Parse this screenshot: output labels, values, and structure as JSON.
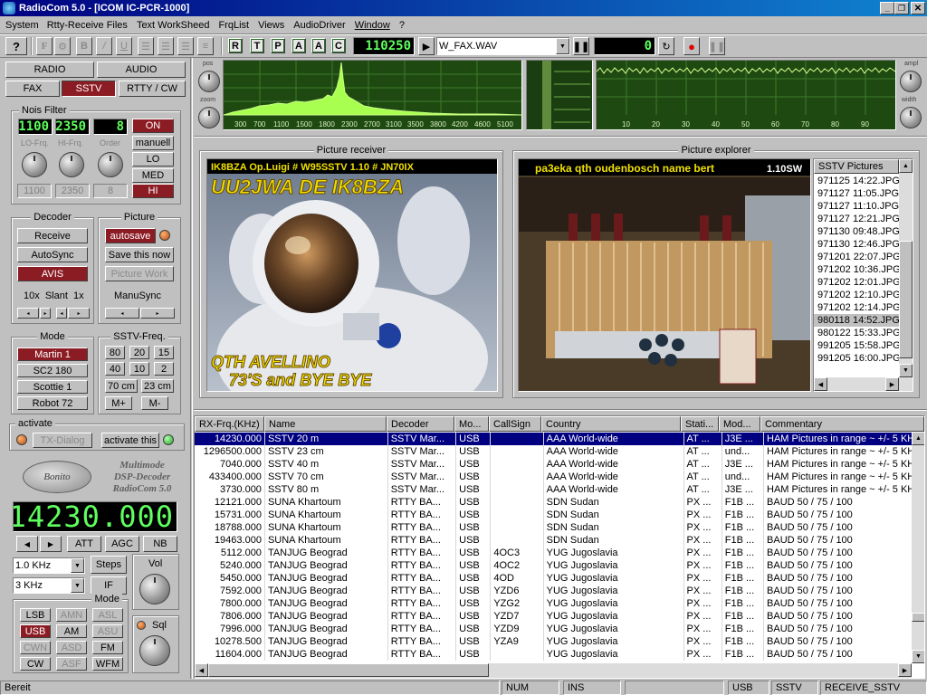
{
  "window": {
    "title": "RadioCom 5.0 - [ICOM IC-PCR-1000]",
    "min_icon": "minimize-icon",
    "max_icon": "restore-icon",
    "close_icon": "close-icon"
  },
  "menu": [
    "System",
    "Rtty-Receive Files",
    "Text WorkSheed",
    "FrqList",
    "Views",
    "AudioDriver",
    "Window",
    "?"
  ],
  "toolbar": {
    "help_icon": "help-icon",
    "format_buttons": [
      "F",
      "",
      "B",
      "/",
      "U",
      "",
      "",
      ""
    ],
    "tool_buttons": [
      "R",
      "T",
      "P",
      "A",
      "A",
      "C"
    ],
    "counter": "110250",
    "file": "W_FAX.WAV",
    "position": "0"
  },
  "mode_tabs": {
    "radio": "RADIO",
    "audio": "AUDIO",
    "fax": "FAX",
    "sstv": "SSTV",
    "rtty": "RTTY / CW"
  },
  "noise_filter": {
    "title": "Nois Filter",
    "lcd": [
      "1100",
      "2350",
      "8"
    ],
    "labels": [
      "LO-Frq.",
      "HI-Frq.",
      "Order"
    ],
    "values": [
      "1100",
      "2350",
      "8"
    ],
    "buttons": [
      "ON",
      "manuell",
      "LO",
      "MED",
      "HI"
    ]
  },
  "decoder": {
    "title": "Decoder",
    "buttons": [
      "Receive",
      "AutoSync",
      "AVIS"
    ],
    "slant": "10x  Slant  1x"
  },
  "picture": {
    "title": "Picture",
    "buttons": [
      "autosave",
      "Save this now",
      "Picture Work"
    ],
    "manusync": "ManuSync"
  },
  "mode": {
    "title": "Mode",
    "items": [
      "Martin 1",
      "SC2 180",
      "Scottie 1",
      "Robot 72"
    ]
  },
  "sstv_freq": {
    "title": "SSTV-Freq.",
    "buttons": [
      "80",
      "20",
      "15",
      "40",
      "10",
      "2",
      "70 cm",
      "23 cm",
      "M+",
      "M-"
    ]
  },
  "activate": {
    "title": "activate",
    "tx_dialog": "TX-Dialog",
    "activate_this": "activate this"
  },
  "brand": {
    "logo": "Bonito",
    "line1": "Multimode",
    "line2": "DSP-Decoder",
    "line3": "RadioCom 5.0"
  },
  "frequency": "14230.000",
  "tuning": {
    "att": "ATT",
    "agc": "AGC",
    "nb": "NB",
    "step_value": "1.0 KHz",
    "steps": "Steps",
    "bw_value": "3 KHz",
    "if": "IF",
    "vol": "Vol",
    "sql": "Sql",
    "mode_title": "Mode",
    "modes": [
      "LSB",
      "AMN",
      "ASL",
      "USB",
      "AM",
      "ASU",
      "CWN",
      "ASD",
      "FM",
      "CW",
      "ASF",
      "WFM"
    ]
  },
  "spectrum": {
    "pos": "pos",
    "zoom": "zoom",
    "ampl": "ampl",
    "width": "width",
    "freq_ticks": [
      "300",
      "700",
      "1100",
      "1500",
      "1800",
      "2300",
      "2700",
      "3100",
      "3500",
      "3800",
      "4200",
      "4600",
      "5100"
    ],
    "time_ticks": [
      "10",
      "20",
      "30",
      "40",
      "50",
      "60",
      "70",
      "80",
      "90"
    ]
  },
  "picture_receiver": {
    "title": "Picture receiver",
    "overlay_top": "IK8BZA  Op.Luigi # W95SSTV  1.10 # JN70IX",
    "overlay_callsign": "UU2JWA DE IK8BZA",
    "overlay_bottom1": "QTH AVELLINO",
    "overlay_bottom2": "73'S and BYE BYE"
  },
  "picture_explorer": {
    "title": "Picture explorer",
    "overlay": "pa3eka qth oudenbosch name bert",
    "overlay_right": "1.10SW",
    "list_header": "SSTV Pictures",
    "files": [
      "971125 14:22.JPG",
      "971127 11:05.JPG",
      "971127 11:10.JPG",
      "971127 12:21.JPG",
      "971130 09:48.JPG",
      "971130 12:46.JPG",
      "971201 22:07.JPG",
      "971202 10:36.JPG",
      "971202 12:01.JPG",
      "971202 12:10.JPG",
      "971202 12:14.JPG",
      "980118 14:52.JPG",
      "980122 15:33.JPG",
      "991205 15:58.JPG",
      "991205 16:00.JPG"
    ],
    "selected_index": 11
  },
  "freq_table": {
    "headers": [
      "RX-Frq.(KHz)",
      "Name",
      "Decoder",
      "Mo...",
      "CallSign",
      "Country",
      "Stati...",
      "Mod...",
      "Commentary"
    ],
    "rows": [
      [
        "14230.000",
        "SSTV 20 m",
        "SSTV Mar...",
        "USB",
        "",
        "AAA World-wide",
        "AT ...",
        "J3E ...",
        "HAM Pictures in range  ~ +/- 5 KHz"
      ],
      [
        "1296500.000",
        "SSTV 23 cm",
        "SSTV Mar...",
        "USB",
        "",
        "AAA World-wide",
        "AT ...",
        "und...",
        "HAM Pictures in range  ~ +/- 5 KHz"
      ],
      [
        "7040.000",
        "SSTV 40 m",
        "SSTV Mar...",
        "USB",
        "",
        "AAA World-wide",
        "AT ...",
        "J3E ...",
        "HAM Pictures in range  ~ +/- 5 KHz"
      ],
      [
        "433400.000",
        "SSTV 70 cm",
        "SSTV Mar...",
        "USB",
        "",
        "AAA World-wide",
        "AT ...",
        "und...",
        "HAM Pictures in range  ~ +/- 5 KHz"
      ],
      [
        "3730.000",
        "SSTV 80 m",
        "SSTV Mar...",
        "USB",
        "",
        "AAA World-wide",
        "AT ...",
        "J3E ...",
        "HAM Pictures in range  ~ +/- 5 KHz"
      ],
      [
        "12121.000",
        "SUNA Khartoum",
        "RTTY BA...",
        "USB",
        "",
        "SDN Sudan",
        "PX ...",
        "F1B ...",
        "BAUD 50 / 75 / 100"
      ],
      [
        "15731.000",
        "SUNA Khartoum",
        "RTTY BA...",
        "USB",
        "",
        "SDN Sudan",
        "PX ...",
        "F1B ...",
        "BAUD 50 / 75 / 100"
      ],
      [
        "18788.000",
        "SUNA Khartoum",
        "RTTY BA...",
        "USB",
        "",
        "SDN Sudan",
        "PX ...",
        "F1B ...",
        "BAUD 50 / 75 / 100"
      ],
      [
        "19463.000",
        "SUNA Khartoum",
        "RTTY BA...",
        "USB",
        "",
        "SDN Sudan",
        "PX ...",
        "F1B ...",
        "BAUD 50 / 75 / 100"
      ],
      [
        "5112.000",
        "TANJUG Beograd",
        "RTTY BA...",
        "USB",
        "4OC3",
        "YUG Jugoslavia",
        "PX ...",
        "F1B ...",
        "BAUD 50 / 75 / 100"
      ],
      [
        "5240.000",
        "TANJUG Beograd",
        "RTTY BA...",
        "USB",
        "4OC2",
        "YUG Jugoslavia",
        "PX ...",
        "F1B ...",
        "BAUD 50 / 75 / 100"
      ],
      [
        "5450.000",
        "TANJUG Beograd",
        "RTTY BA...",
        "USB",
        "4OD",
        "YUG Jugoslavia",
        "PX ...",
        "F1B ...",
        "BAUD 50 / 75 / 100"
      ],
      [
        "7592.000",
        "TANJUG Beograd",
        "RTTY BA...",
        "USB",
        "YZD6",
        "YUG Jugoslavia",
        "PX ...",
        "F1B ...",
        "BAUD 50 / 75 / 100"
      ],
      [
        "7800.000",
        "TANJUG Beograd",
        "RTTY BA...",
        "USB",
        "YZG2",
        "YUG Jugoslavia",
        "PX ...",
        "F1B ...",
        "BAUD 50 / 75 / 100"
      ],
      [
        "7806.000",
        "TANJUG Beograd",
        "RTTY BA...",
        "USB",
        "YZD7",
        "YUG Jugoslavia",
        "PX ...",
        "F1B ...",
        "BAUD 50 / 75 / 100"
      ],
      [
        "7996.000",
        "TANJUG Beograd",
        "RTTY BA...",
        "USB",
        "YZD9",
        "YUG Jugoslavia",
        "PX ...",
        "F1B ...",
        "BAUD 50 / 75 / 100"
      ],
      [
        "10278.500",
        "TANJUG Beograd",
        "RTTY BA...",
        "USB",
        "YZA9",
        "YUG Jugoslavia",
        "PX ...",
        "F1B ...",
        "BAUD 50 / 75 / 100"
      ],
      [
        "11604.000",
        "TANJUG Beograd",
        "RTTY BA...",
        "USB",
        "",
        "YUG Jugoslavia",
        "PX ...",
        "F1B ...",
        "BAUD 50 / 75 / 100"
      ]
    ]
  },
  "status": {
    "ready": "Bereit",
    "num": "NUM",
    "ins": "INS",
    "usb": "USB",
    "sstv": "SSTV",
    "state": "RECEIVE_SSTV"
  },
  "colors": {
    "title_bar": "#000080",
    "lcd_green": "#5fff5f",
    "active_red": "#8c1c24",
    "spectrum_bg": "#1e4a12",
    "selection": "#000080"
  }
}
